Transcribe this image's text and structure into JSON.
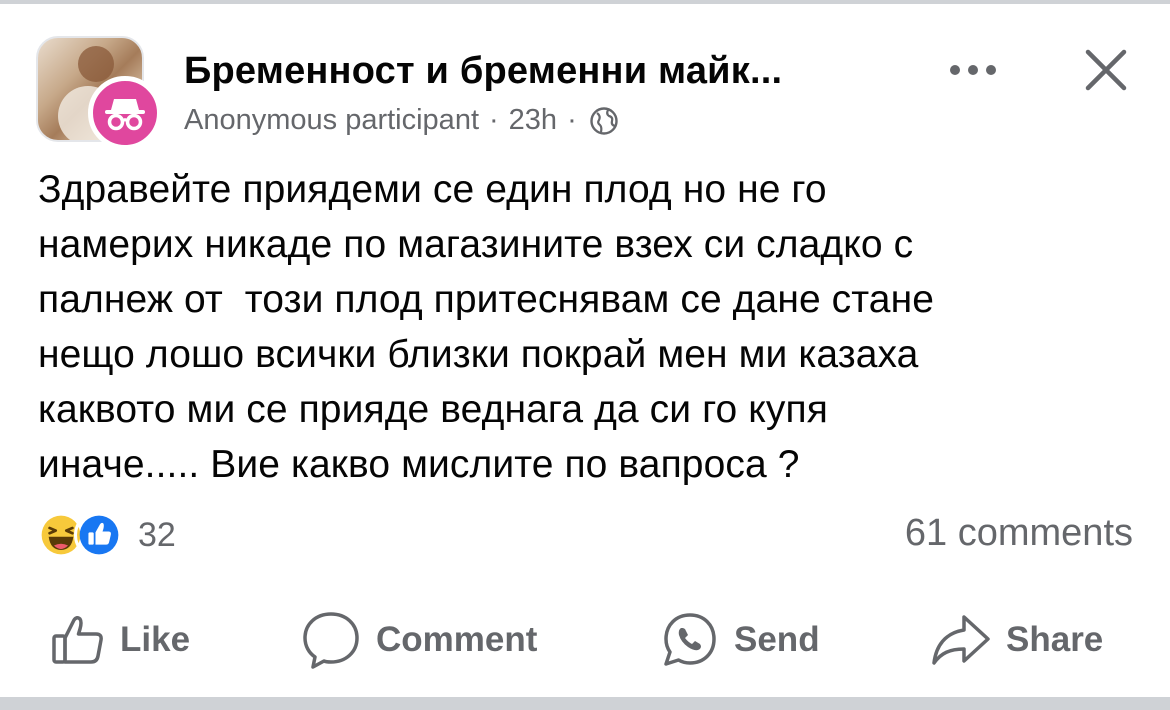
{
  "post": {
    "group_name": "Бременност и бременни майк...",
    "author": "Anonymous participant",
    "separator": "·",
    "time": "23h",
    "privacy_icon": "globe-icon",
    "text": "Здравейте приядеми се един плод но не го\nнамерих никаде по магазините взех си сладко с\nпалнеж от  този плод притеснявам се дане стане\nнещо лошо всички близки покрай мен ми казаха\nкаквото ми се прияде веднага да си го купя\nиначе..... Вие какво мислите по вапроса ?"
  },
  "header": {
    "more_icon": "more-horizontal-icon",
    "close_icon": "close-icon",
    "badge_icon": "anonymous-incognito-icon"
  },
  "stats": {
    "reaction_icons": [
      "haha-reaction-icon",
      "like-reaction-icon"
    ],
    "reactions_count": "32",
    "comments": "61 comments"
  },
  "actions": {
    "like": "Like",
    "comment": "Comment",
    "send": "Send",
    "share": "Share"
  },
  "colors": {
    "badge": "#e0479e",
    "like_blue": "#1877f2",
    "haha_yellow": "#f7c93b",
    "secondary_text": "#65676b",
    "primary_text": "#050505"
  }
}
